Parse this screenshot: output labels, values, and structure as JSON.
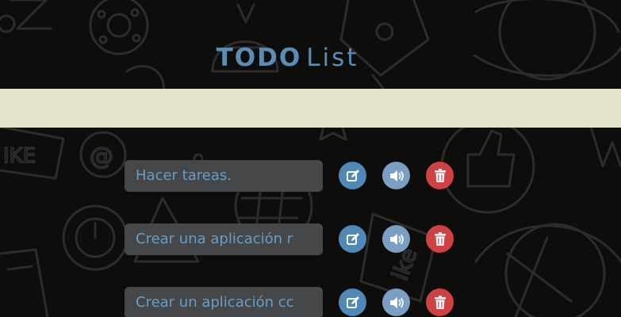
{
  "header": {
    "title_strong": "TODO",
    "title_light": "List"
  },
  "new_task": {
    "value": "",
    "placeholder": ""
  },
  "tasks": [
    {
      "text": "Hacer tareas."
    },
    {
      "text": "Crear una aplicación r"
    },
    {
      "text": "Crear un aplicación cc"
    }
  ],
  "icons": {
    "edit": "edit-icon",
    "speak": "speaker-icon",
    "delete": "trash-icon"
  },
  "colors": {
    "background": "#0d0d0b",
    "title": "#5a8db6",
    "input_band": "#e4e2ca",
    "task_field": "#454749",
    "task_text": "#6a9cc5",
    "edit_button": "#4f89b8",
    "speak_button": "#7a9fc2",
    "delete_button": "#d04242"
  }
}
